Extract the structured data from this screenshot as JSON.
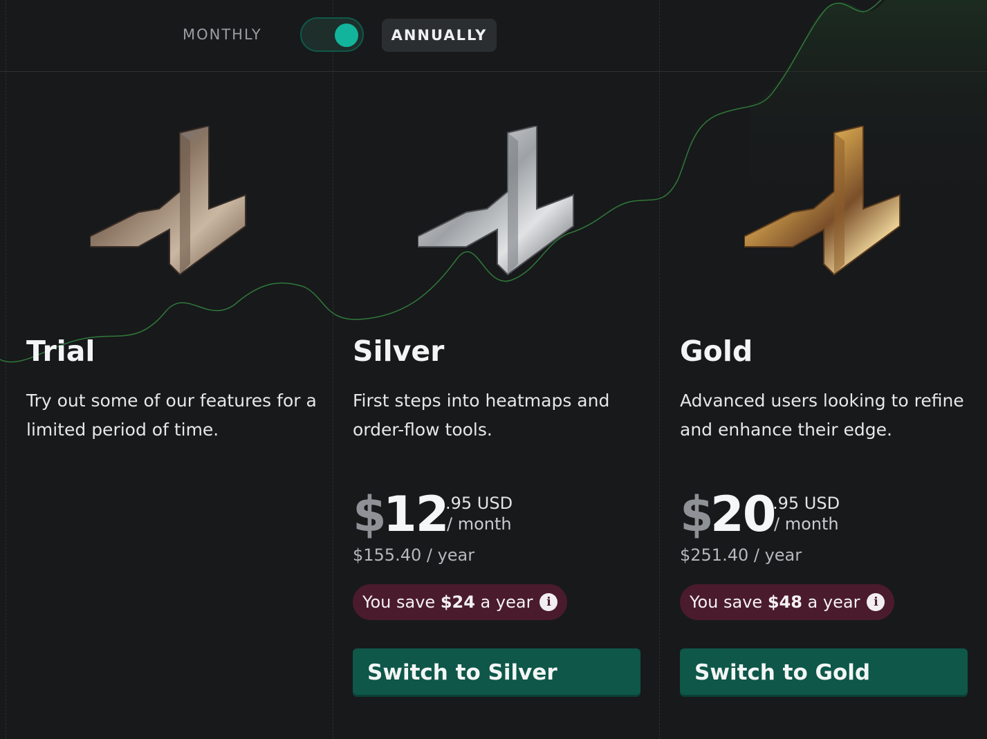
{
  "billing_toggle": {
    "monthly_label": "MONTHLY",
    "annually_label": "ANNUALLY",
    "selected": "annually"
  },
  "colors": {
    "background": "#18191b",
    "accent": "#12b59b",
    "button": "#0e5749",
    "save_badge": "#4a1b2d",
    "growth_line": "#2f7a3a"
  },
  "plans": [
    {
      "name": "Trial",
      "description": "Try out some of our features for a limited period of time.",
      "logo": "wood-logo-icon"
    },
    {
      "name": "Silver",
      "description": "First steps into heatmaps and order-flow tools.",
      "logo": "silver-logo-icon",
      "price_symbol": "$",
      "price_integer": "12",
      "price_decimal": ".95 USD",
      "price_period": "/ month",
      "price_yearly": "$155.40 / year",
      "save_prefix": "You save ",
      "save_amount": "$24",
      "save_suffix": " a year",
      "button_label": "Switch to Silver"
    },
    {
      "name": "Gold",
      "description": "Advanced users looking to refine and enhance their edge.",
      "logo": "gold-logo-icon",
      "price_symbol": "$",
      "price_integer": "20",
      "price_decimal": ".95 USD",
      "price_period": "/ month",
      "price_yearly": "$251.40 / year",
      "save_prefix": "You save ",
      "save_amount": "$48",
      "save_suffix": " a year",
      "button_label": "Switch to Gold"
    }
  ]
}
